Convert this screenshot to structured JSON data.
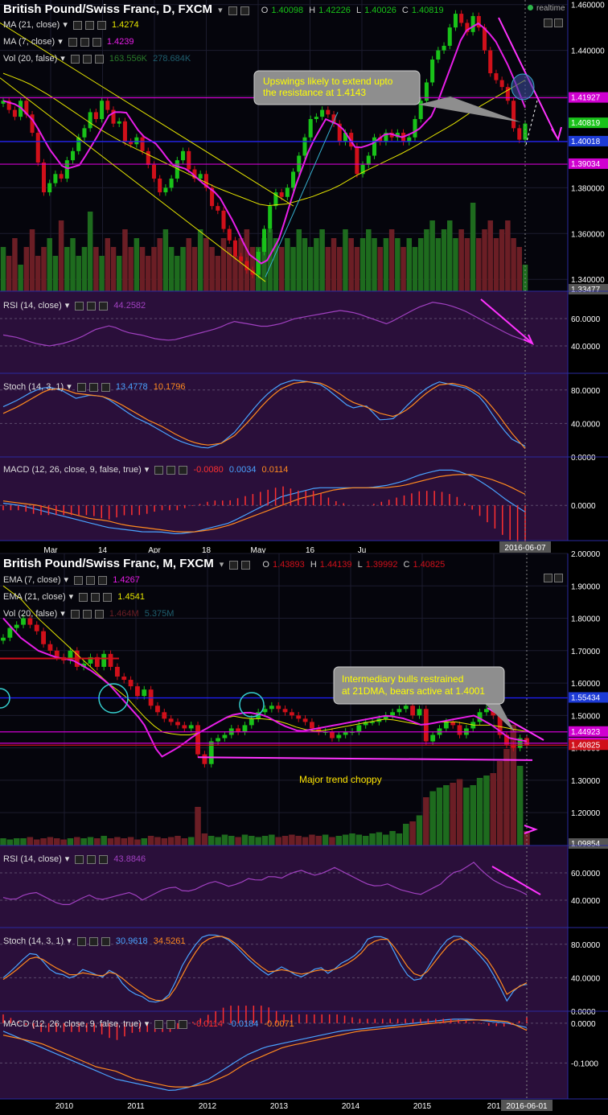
{
  "colors": {
    "bg": "#000000",
    "grid": "#1c1c2e",
    "axis_text": "#ffffff",
    "up": "#19c219",
    "down": "#d0101a",
    "ma21": "#e4e400",
    "ma7": "#e81ee8",
    "vol_up": "#1e6b1e",
    "vol_down": "#6b1e25",
    "vol_ma": "#36b0d0",
    "blue_line": "#2020ff",
    "magenta_line": "#d000d0",
    "osc_bg": "#2a0f3a",
    "k_line": "#4aa3ff",
    "d_line": "#ff8a1f",
    "macd_hist": "#ff3030",
    "annotation_bg": "#8e8e8e",
    "annotation_text": "#ffff00",
    "trend_text": "#ffe600"
  },
  "daily": {
    "title": "British Pound/Swiss Franc, D, FXCM",
    "realtime": "realtime",
    "ohlc": {
      "o_label": "O",
      "o": "1.40098",
      "h_label": "H",
      "h": "1.42226",
      "l_label": "L",
      "l": "1.40026",
      "c_label": "C",
      "c": "1.40819"
    },
    "indicators": [
      {
        "label": "MA (21, close)",
        "values": [
          "1.4274"
        ]
      },
      {
        "label": "MA (7, close)",
        "values": [
          "1.4239"
        ]
      },
      {
        "label": "Vol (20, false)",
        "values": [
          "163.556K",
          "278.684K"
        ]
      }
    ],
    "y_ticks": [
      "1.460000",
      "1.440000",
      "1.420000",
      "1.400000",
      "1.380000",
      "1.360000",
      "1.340000"
    ],
    "price_tags": [
      {
        "text": "1.41927",
        "color": "#d000d0"
      },
      {
        "text": "1.40819",
        "color": "#19c219"
      },
      {
        "text": "1.40018",
        "color": "#1d3bd6"
      },
      {
        "text": "1.39034",
        "color": "#d000d0"
      },
      {
        "text": "1.33477",
        "color": "#555555"
      }
    ],
    "x_labels": [
      "Mar",
      "14",
      "Apr",
      "18",
      "May",
      "16",
      "Ju"
    ],
    "date_tag": "2016-06-07",
    "annotation": "Upswings likely to extend upto the resistance at 1.4143",
    "rsi": {
      "label": "RSI (14, close)",
      "values": [
        "44.2582"
      ],
      "ticks": [
        "60.0000",
        "40.0000"
      ]
    },
    "stoch": {
      "label": "Stoch (14, 3, 1)",
      "values": [
        "13.4778",
        "10.1796"
      ],
      "ticks": [
        "80.0000",
        "40.0000",
        "0.0000"
      ]
    },
    "macd": {
      "label": "MACD (12, 26, close, 9, false, true)",
      "values": [
        "-0.0080",
        "0.0034",
        "0.0114"
      ],
      "ticks": [
        "0.0000"
      ]
    }
  },
  "monthly": {
    "title": "British Pound/Swiss Franc, M, FXCM",
    "ohlc": {
      "o_label": "O",
      "o": "1.43893",
      "h_label": "H",
      "h": "1.44139",
      "l_label": "L",
      "l": "1.39992",
      "c_label": "C",
      "c": "1.40825"
    },
    "indicators": [
      {
        "label": "EMA (7, close)",
        "values": [
          "1.4267"
        ]
      },
      {
        "label": "EMA (21, close)",
        "values": [
          "1.4541"
        ]
      },
      {
        "label": "Vol (20, false)",
        "values": [
          "1.464M",
          "5.375M"
        ]
      }
    ],
    "y_ticks": [
      "2.00000",
      "1.90000",
      "1.80000",
      "1.70000",
      "1.60000",
      "1.50000",
      "1.40000",
      "1.30000",
      "1.20000"
    ],
    "price_tags": [
      {
        "text": "1.55434",
        "color": "#1d3bd6"
      },
      {
        "text": "1.44923",
        "color": "#d000d0"
      },
      {
        "text": "1.41432",
        "color": "#d000d0"
      },
      {
        "text": "1.40825",
        "color": "#d0101a"
      },
      {
        "text": "1.09854",
        "color": "#555555"
      }
    ],
    "x_labels": [
      "2010",
      "2011",
      "2012",
      "2013",
      "2014",
      "2015",
      "201"
    ],
    "date_tag": "2016-06-01",
    "annotation": "Intermediary bulls restrained at 21DMA, bears active at 1.4001",
    "trend_text": "Major trend choppy",
    "rsi": {
      "label": "RSI (14, close)",
      "values": [
        "43.8846"
      ],
      "ticks": [
        "60.0000",
        "40.0000"
      ]
    },
    "stoch": {
      "label": "Stoch (14, 3, 1)",
      "values": [
        "30.9618",
        "34.5261"
      ],
      "ticks": [
        "80.0000",
        "40.0000",
        "0.0000"
      ]
    },
    "macd": {
      "label": "MACD (12, 26, close, 9, false, true)",
      "values": [
        "-0.0114",
        "-0.0184",
        "-0.0071"
      ],
      "ticks": [
        "0.0000",
        "-0.1000"
      ]
    }
  },
  "chart_data": [
    {
      "type": "candlestick",
      "title": "British Pound/Swiss Franc, D, FXCM",
      "timeframe": "D",
      "ylim": [
        1.3348,
        1.462
      ],
      "x_labels": [
        "Mar",
        "14",
        "Apr",
        "18",
        "May",
        "16",
        "Ju"
      ],
      "closes": [
        1.418,
        1.414,
        1.411,
        1.418,
        1.412,
        1.404,
        1.391,
        1.378,
        1.382,
        1.386,
        1.384,
        1.392,
        1.396,
        1.402,
        1.406,
        1.413,
        1.41,
        1.418,
        1.414,
        1.408,
        1.409,
        1.4,
        1.399,
        1.402,
        1.396,
        1.39,
        1.384,
        1.378,
        1.38,
        1.384,
        1.392,
        1.396,
        1.388,
        1.384,
        1.386,
        1.38,
        1.372,
        1.37,
        1.362,
        1.357,
        1.35,
        1.348,
        1.344,
        1.342,
        1.352,
        1.362,
        1.372,
        1.378,
        1.376,
        1.38,
        1.387,
        1.394,
        1.402,
        1.41,
        1.411,
        1.414,
        1.412,
        1.408,
        1.4,
        1.404,
        1.398,
        1.386,
        1.39,
        1.394,
        1.402,
        1.4,
        1.404,
        1.402,
        1.404,
        1.4,
        1.402,
        1.41,
        1.418,
        1.426,
        1.436,
        1.44,
        1.442,
        1.45,
        1.456,
        1.452,
        1.448,
        1.455,
        1.45,
        1.44,
        1.43,
        1.427,
        1.424,
        1.418,
        1.406,
        1.401,
        1.408
      ],
      "ma21": [
        1.43,
        1.426,
        1.42,
        1.413,
        1.406,
        1.4,
        1.395,
        1.39,
        1.385,
        1.38,
        1.376,
        1.372,
        1.373,
        1.376,
        1.38,
        1.386,
        1.391,
        1.396,
        1.402,
        1.408,
        1.415,
        1.421,
        1.427
      ],
      "ma7": [
        1.418,
        1.416,
        1.409,
        1.397,
        1.388,
        1.39,
        1.401,
        1.413,
        1.413,
        1.403,
        1.399,
        1.39,
        1.388,
        1.382,
        1.377,
        1.365,
        1.351,
        1.346,
        1.358,
        1.38,
        1.398,
        1.41,
        1.407,
        1.397,
        1.399,
        1.404,
        1.402,
        1.405,
        1.412,
        1.43,
        1.448,
        1.452,
        1.445,
        1.432,
        1.415
      ],
      "volume_relative": [
        0.5,
        0.4,
        0.6,
        0.3,
        0.5,
        0.7,
        0.4,
        0.5,
        0.6,
        0.4,
        0.8,
        0.5,
        0.6,
        0.4,
        0.5,
        0.9,
        0.5,
        0.4,
        0.6,
        0.5,
        0.4,
        0.7,
        0.5,
        0.6,
        0.5,
        0.4,
        0.5,
        0.6,
        0.7,
        0.5,
        0.4,
        0.5,
        0.6,
        0.5,
        0.7,
        0.6,
        0.5,
        0.4,
        0.6,
        0.5,
        0.4,
        0.6,
        0.7,
        0.5,
        0.5,
        0.6,
        0.7,
        0.6,
        0.5,
        0.6,
        0.5,
        0.7,
        0.6,
        0.5,
        0.6,
        0.7,
        0.5,
        0.6,
        0.5,
        0.7,
        0.6,
        0.5,
        0.6,
        0.7,
        0.6,
        0.5,
        0.6,
        0.7,
        0.6,
        0.5,
        0.6,
        0.5,
        0.6,
        0.7,
        0.8,
        0.6,
        0.7,
        0.8,
        0.6,
        0.7,
        0.6,
        1.0,
        0.6,
        0.7,
        0.8,
        0.6,
        0.7,
        0.8,
        0.6,
        0.5,
        0.3
      ],
      "horizontal_levels": [
        {
          "y": 1.4193,
          "color": "#d000d0"
        },
        {
          "y": 1.4002,
          "color": "#2020ff"
        },
        {
          "y": 1.3903,
          "color": "#d000d0"
        }
      ],
      "rsi": [
        48,
        46,
        42,
        40,
        42,
        46,
        52,
        55,
        50,
        48,
        45,
        44,
        47,
        50,
        53,
        58,
        56,
        54,
        56,
        60,
        62,
        64,
        66,
        64,
        60,
        56,
        62,
        68,
        72,
        70,
        66,
        60,
        54,
        48,
        44
      ],
      "stoch_k": [
        60,
        68,
        78,
        84,
        80,
        70,
        74,
        72,
        60,
        48,
        40,
        30,
        20,
        14,
        10,
        16,
        30,
        52,
        72,
        86,
        92,
        90,
        86,
        72,
        58,
        62,
        44,
        46,
        64,
        80,
        90,
        86,
        82,
        70,
        44,
        22,
        13
      ],
      "stoch_d": [
        52,
        60,
        70,
        80,
        82,
        76,
        74,
        72,
        64,
        54,
        44,
        36,
        26,
        18,
        14,
        16,
        26,
        44,
        64,
        80,
        88,
        90,
        88,
        78,
        66,
        60,
        52,
        48,
        58,
        74,
        86,
        88,
        84,
        74,
        54,
        30,
        10
      ],
      "macd": [
        0.001,
        0.0,
        -0.002,
        -0.004,
        -0.006,
        -0.008,
        -0.01,
        -0.011,
        -0.012,
        -0.012,
        -0.013,
        -0.012,
        -0.01,
        -0.008,
        -0.004,
        0.0,
        0.004,
        0.006,
        0.008,
        0.008,
        0.008,
        0.008,
        0.009,
        0.011,
        0.014,
        0.016,
        0.016,
        0.013,
        0.008,
        0.002,
        -0.003
      ],
      "macd_signal": [
        0.002,
        0.001,
        0.0,
        -0.002,
        -0.004,
        -0.006,
        -0.007,
        -0.009,
        -0.01,
        -0.011,
        -0.012,
        -0.012,
        -0.011,
        -0.009,
        -0.006,
        -0.003,
        0.0,
        0.003,
        0.005,
        0.007,
        0.008,
        0.008,
        0.008,
        0.009,
        0.011,
        0.013,
        0.014,
        0.014,
        0.012,
        0.009,
        0.005
      ],
      "macd_ylim": [
        -0.016,
        0.022
      ]
    },
    {
      "type": "candlestick",
      "title": "British Pound/Swiss Franc, M, FXCM",
      "timeframe": "M",
      "ylim": [
        1.0985,
        2.0
      ],
      "x_labels": [
        "2010",
        "2011",
        "2012",
        "2013",
        "2014",
        "2015",
        "201"
      ],
      "closes": [
        1.74,
        1.77,
        1.78,
        1.8,
        1.78,
        1.76,
        1.72,
        1.7,
        1.68,
        1.67,
        1.7,
        1.65,
        1.66,
        1.68,
        1.65,
        1.69,
        1.65,
        1.62,
        1.61,
        1.59,
        1.56,
        1.58,
        1.53,
        1.51,
        1.49,
        1.48,
        1.47,
        1.46,
        1.47,
        1.38,
        1.35,
        1.42,
        1.43,
        1.44,
        1.46,
        1.45,
        1.47,
        1.49,
        1.51,
        1.52,
        1.53,
        1.52,
        1.51,
        1.5,
        1.49,
        1.48,
        1.46,
        1.45,
        1.45,
        1.43,
        1.44,
        1.45,
        1.45,
        1.47,
        1.48,
        1.48,
        1.49,
        1.5,
        1.51,
        1.52,
        1.53,
        1.5,
        1.52,
        1.42,
        1.44,
        1.46,
        1.48,
        1.47,
        1.44,
        1.46,
        1.48,
        1.51,
        1.52,
        1.5,
        1.44,
        1.41,
        1.4,
        1.43,
        1.408
      ],
      "ema21": [
        1.9,
        1.86,
        1.8,
        1.75,
        1.7,
        1.65,
        1.6,
        1.56,
        1.5,
        1.45,
        1.44,
        1.44,
        1.47,
        1.5,
        1.49,
        1.49,
        1.48,
        1.46,
        1.45,
        1.46,
        1.47,
        1.48,
        1.49,
        1.48,
        1.47,
        1.48,
        1.48,
        1.47,
        1.47,
        1.46,
        1.45
      ],
      "ema7": [
        1.8,
        1.74,
        1.7,
        1.68,
        1.67,
        1.64,
        1.6,
        1.54,
        1.48,
        1.37,
        1.4,
        1.44,
        1.47,
        1.5,
        1.51,
        1.5,
        1.47,
        1.45,
        1.46,
        1.47,
        1.48,
        1.49,
        1.5,
        1.49,
        1.47,
        1.48,
        1.49,
        1.5,
        1.47,
        1.43,
        1.42
      ],
      "volume_relative": [
        0.06,
        0.05,
        0.06,
        0.06,
        0.07,
        0.05,
        0.06,
        0.07,
        0.06,
        0.05,
        0.06,
        0.07,
        0.06,
        0.07,
        0.06,
        0.08,
        0.06,
        0.07,
        0.06,
        0.07,
        0.05,
        0.06,
        0.08,
        0.07,
        0.06,
        0.07,
        0.08,
        0.06,
        0.07,
        0.32,
        0.1,
        0.08,
        0.07,
        0.09,
        0.08,
        0.07,
        0.09,
        0.08,
        0.07,
        0.08,
        0.09,
        0.07,
        0.08,
        0.09,
        0.08,
        0.07,
        0.09,
        0.08,
        0.09,
        0.07,
        0.08,
        0.09,
        0.1,
        0.09,
        0.08,
        0.1,
        0.11,
        0.09,
        0.12,
        0.1,
        0.18,
        0.2,
        0.25,
        0.4,
        0.45,
        0.48,
        0.5,
        0.52,
        0.55,
        0.48,
        0.5,
        0.56,
        0.58,
        0.6,
        0.7,
        0.8,
        1.0,
        0.66,
        0.12
      ],
      "horizontal_levels": [
        {
          "y": 1.5543,
          "color": "#2020ff"
        },
        {
          "y": 1.4492,
          "color": "#d000d0"
        },
        {
          "y": 1.4143,
          "color": "#d000d0"
        },
        {
          "y": 1.4082,
          "color": "#d0101a"
        }
      ],
      "rsi": [
        42,
        40,
        44,
        46,
        42,
        38,
        36,
        40,
        44,
        40,
        42,
        44,
        46,
        40,
        44,
        48,
        50,
        46,
        48,
        52,
        54,
        50,
        52,
        56,
        54,
        58,
        56,
        60,
        62,
        58,
        60,
        64,
        60,
        56,
        52,
        50,
        52,
        48,
        46,
        44,
        48,
        52,
        60,
        62,
        68,
        60,
        54,
        50,
        48,
        44
      ],
      "stoch_k": [
        40,
        50,
        62,
        72,
        60,
        46,
        44,
        38,
        50,
        46,
        40,
        52,
        34,
        22,
        18,
        10,
        12,
        22,
        52,
        72,
        88,
        92,
        90,
        84,
        72,
        60,
        50,
        42,
        54,
        48,
        40,
        46,
        54,
        44,
        56,
        62,
        70,
        88,
        90,
        86,
        60,
        42,
        34,
        52,
        72,
        86,
        92,
        82,
        70,
        56,
        36,
        12,
        30,
        32
      ],
      "stoch_d": [
        38,
        46,
        56,
        66,
        62,
        54,
        48,
        42,
        46,
        44,
        42,
        48,
        40,
        30,
        22,
        14,
        12,
        18,
        40,
        62,
        80,
        88,
        90,
        86,
        76,
        64,
        54,
        46,
        50,
        48,
        44,
        46,
        50,
        48,
        52,
        58,
        66,
        80,
        86,
        86,
        70,
        52,
        40,
        48,
        64,
        78,
        88,
        84,
        74,
        62,
        44,
        20,
        28,
        34
      ],
      "macd": [
        -0.02,
        -0.04,
        -0.06,
        -0.08,
        -0.1,
        -0.12,
        -0.14,
        -0.15,
        -0.16,
        -0.17,
        -0.16,
        -0.14,
        -0.11,
        -0.08,
        -0.06,
        -0.05,
        -0.04,
        -0.03,
        -0.02,
        -0.015,
        -0.01,
        -0.005,
        0.0,
        0.005,
        0.01,
        0.01,
        0.005,
        0.0,
        -0.011
      ],
      "macd_signal": [
        -0.03,
        -0.04,
        -0.05,
        -0.07,
        -0.09,
        -0.11,
        -0.12,
        -0.14,
        -0.15,
        -0.16,
        -0.16,
        -0.15,
        -0.13,
        -0.1,
        -0.08,
        -0.06,
        -0.05,
        -0.04,
        -0.03,
        -0.02,
        -0.015,
        -0.01,
        -0.005,
        0.0,
        0.005,
        0.008,
        0.008,
        0.004,
        -0.018
      ],
      "macd_ylim": [
        -0.19,
        0.03
      ]
    }
  ]
}
